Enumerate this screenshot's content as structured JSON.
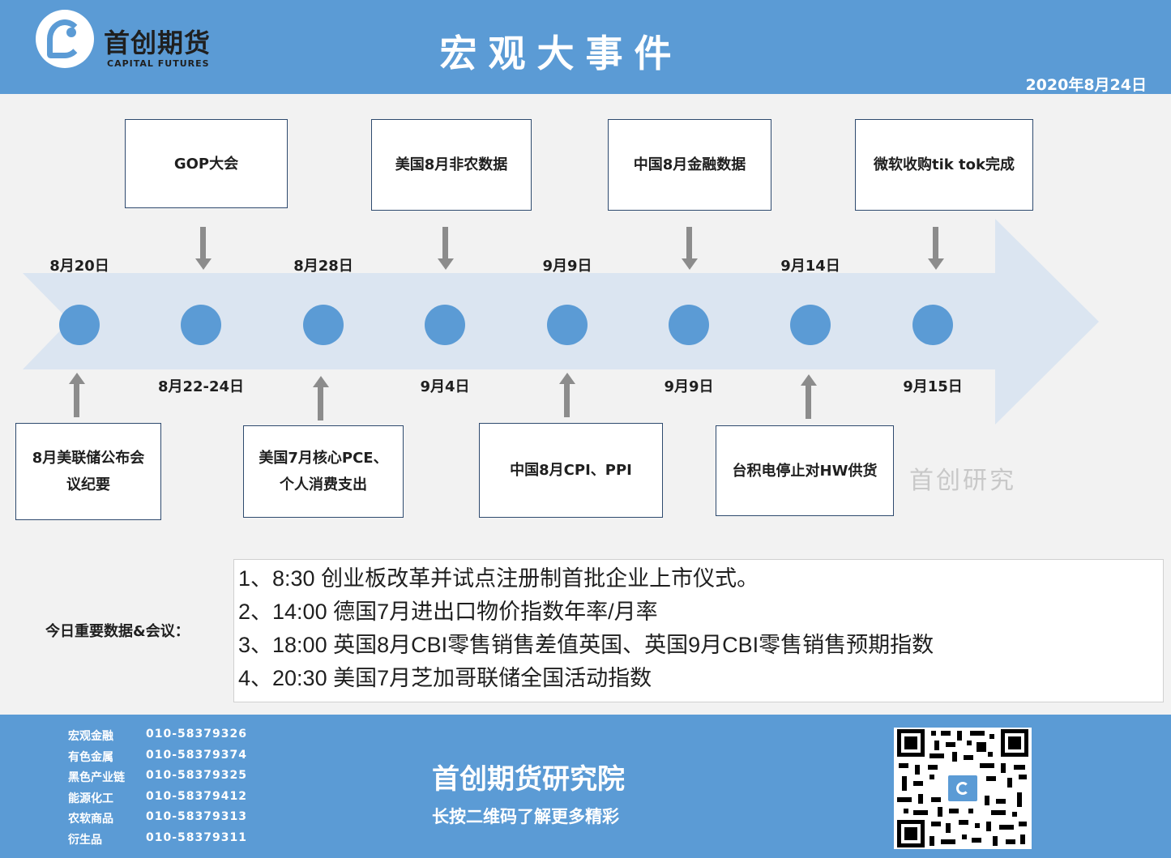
{
  "header": {
    "logo_cn": "首创期货",
    "logo_en": "CAPITAL FUTURES",
    "title": "宏观大事件",
    "date": "2020年8月24日"
  },
  "timeline": {
    "top_dates": [
      "8月20日",
      "8月28日",
      "9月9日",
      "9月14日"
    ],
    "bottom_dates": [
      "8月22-24日",
      "9月4日",
      "9月9日",
      "9月15日"
    ],
    "top_events": [
      "GOP大会",
      "美国8月非农数据",
      "中国8月金融数据",
      "微软收购tik tok完成"
    ],
    "bottom_events": [
      "8月美联储公布会议纪要",
      "美国7月核心PCE、个人消费支出",
      "中国8月CPI、PPI",
      "台积电停止对HW供货"
    ],
    "watermark": "首创研究"
  },
  "today": {
    "label": "今日重要数据&会议：",
    "items": [
      "1、8:30 创业板改革并试点注册制首批企业上市仪式。",
      "2、14:00 德国7月进出口物价指数年率/月率",
      "3、18:00 英国8月CBI零售销售差值英国、英国9月CBI零售销售预期指数",
      "4、20:30 美国7月芝加哥联储全国活动指数"
    ]
  },
  "footer": {
    "contacts": [
      {
        "name": "宏观金融",
        "phone": "010-58379326"
      },
      {
        "name": "有色金属",
        "phone": "010-58379374"
      },
      {
        "name": "黑色产业链",
        "phone": "010-58379325"
      },
      {
        "name": "能源化工",
        "phone": "010-58379412"
      },
      {
        "name": "农软商品",
        "phone": "010-58379313"
      },
      {
        "name": "衍生品",
        "phone": "010-58379311"
      }
    ],
    "title": "首创期货研究院",
    "subtitle": "长按二维码了解更多精彩"
  },
  "colors": {
    "brand_blue": "#5b9bd5",
    "arrow_fill": "#dbe5f1",
    "connector_gray": "#8c8c8c"
  }
}
